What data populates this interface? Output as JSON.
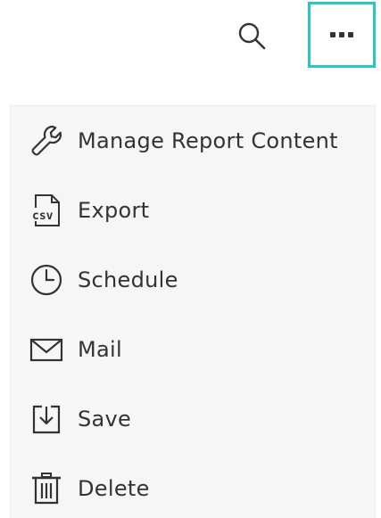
{
  "toolbar": {
    "search_icon": "search-icon",
    "more_icon": "more-horizontal-icon",
    "accent": "#29c6c4"
  },
  "menu": {
    "items": [
      {
        "label": "Manage Report Content",
        "icon": "wrench-icon"
      },
      {
        "label": "Export",
        "icon": "csv-file-icon"
      },
      {
        "label": "Schedule",
        "icon": "clock-icon"
      },
      {
        "label": "Mail",
        "icon": "envelope-icon"
      },
      {
        "label": "Save",
        "icon": "save-download-icon"
      },
      {
        "label": "Delete",
        "icon": "trash-icon"
      }
    ],
    "csv_icon_text": "csv"
  }
}
